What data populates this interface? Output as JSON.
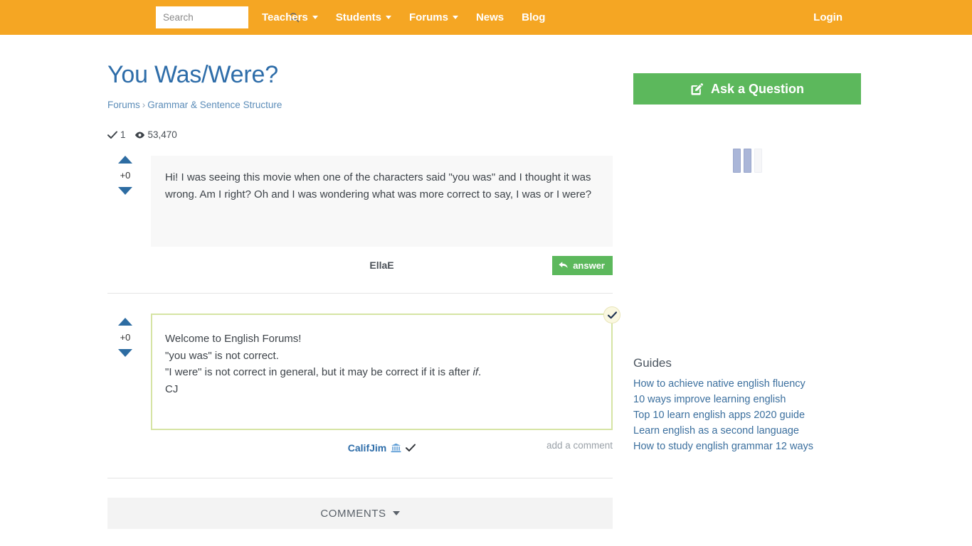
{
  "topbar": {
    "search": {
      "placeholder": "Search",
      "value": "",
      "icon": "search-icon"
    },
    "nav": [
      {
        "label": "Teachers",
        "has_dropdown": true
      },
      {
        "label": "Students",
        "has_dropdown": true
      },
      {
        "label": "Forums",
        "has_dropdown": true
      },
      {
        "label": "News",
        "has_dropdown": false
      },
      {
        "label": "Blog",
        "has_dropdown": false
      }
    ],
    "login_label": "Login",
    "background_color": "#f5a623"
  },
  "page": {
    "title": "You Was/Were?",
    "title_color": "#2e6da9",
    "breadcrumb": {
      "root": "Forums",
      "separator": "›",
      "current": "Grammar & Sentence Structure"
    },
    "stats": {
      "answers_icon": "check-icon",
      "answers": "1",
      "views_icon": "eye-icon",
      "views": "53,470"
    }
  },
  "question": {
    "votes": {
      "up_icon": "vote-up-icon",
      "count": "+0",
      "down_icon": "vote-down-icon"
    },
    "body": "Hi! I was seeing this movie when one of the characters said \"you was\" and I thought it was wrong. Am I right? Oh and I was wondering what was more correct to say, I was or I were?",
    "author": "EllaE",
    "answer_button": {
      "label": "answer",
      "icon": "reply-arrow-icon",
      "color": "#5cb85c"
    }
  },
  "answer": {
    "votes": {
      "up_icon": "vote-up-icon",
      "count": "+0",
      "down_icon": "vote-down-icon"
    },
    "accepted_badge_icon": "accepted-check-icon",
    "border_color": "#d6e4a4",
    "lines": [
      "Welcome to English Forums!",
      "\"you was\" is not correct.",
      "\"I were\" is not correct in general, but it may be correct if it is after ",
      "CJ"
    ],
    "emphasis_word": "if",
    "emphasis_trailing": ".",
    "author": "CalifJim",
    "author_badges": [
      "bank-icon",
      "verified-check-icon"
    ],
    "add_comment_label": "add a comment"
  },
  "comments": {
    "label": "COMMENTS",
    "toggle_icon": "chevron-down-icon"
  },
  "sidebar": {
    "ask_button": {
      "label": "Ask a Question",
      "icon": "edit-pencil-icon",
      "color": "#5cb85c"
    },
    "loader": {
      "name": "loading-indicator"
    },
    "guides": {
      "title": "Guides",
      "links": [
        "How to achieve native english fluency",
        "10 ways improve learning english",
        "Top 10 learn english apps 2020 guide",
        "Learn english as a second language",
        "How to study english grammar 12 ways"
      ]
    }
  }
}
